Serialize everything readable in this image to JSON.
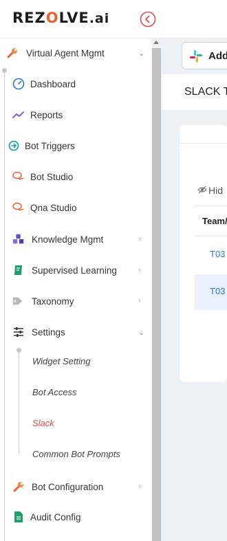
{
  "brand": {
    "logo_prefix": "REZ",
    "logo_o": "O",
    "logo_suffix": "LVE",
    "logo_ai": ".ai"
  },
  "colors": {
    "accent": "#e9612c",
    "link": "#2a7bd8",
    "active": "#e24a4a"
  },
  "sidebar": {
    "items": [
      {
        "label": "Virtual Agent Mgmt",
        "icon": "wrench-icon",
        "expanded": true
      },
      {
        "label": "Dashboard",
        "icon": "gauge-icon"
      },
      {
        "label": "Reports",
        "icon": "trend-line-icon"
      },
      {
        "label": "Bot Triggers",
        "icon": "arrow-circle-icon"
      },
      {
        "label": "Bot Studio",
        "icon": "chat-bubbles-icon"
      },
      {
        "label": "Qna Studio",
        "icon": "chat-bubbles-icon"
      },
      {
        "label": "Knowledge Mgmt",
        "icon": "cubes-icon"
      },
      {
        "label": "Supervised Learning",
        "icon": "book-icon"
      },
      {
        "label": "Taxonomy",
        "icon": "tags-icon"
      },
      {
        "label": "Settings",
        "icon": "sliders-icon",
        "expanded": true
      },
      {
        "label": "Bot Configuration",
        "icon": "wrench-icon"
      },
      {
        "label": "Audit Config",
        "icon": "document-icon"
      }
    ],
    "settings_sub": [
      {
        "label": "Widget Setting"
      },
      {
        "label": "Bot Access"
      },
      {
        "label": "Slack",
        "active": true
      },
      {
        "label": "Common Bot Prompts"
      }
    ]
  },
  "main": {
    "add_button_label": "Add",
    "page_title": "SLACK T",
    "hide_label": "Hid",
    "table": {
      "header": "Team/",
      "rows": [
        "T03",
        "T03"
      ]
    }
  }
}
